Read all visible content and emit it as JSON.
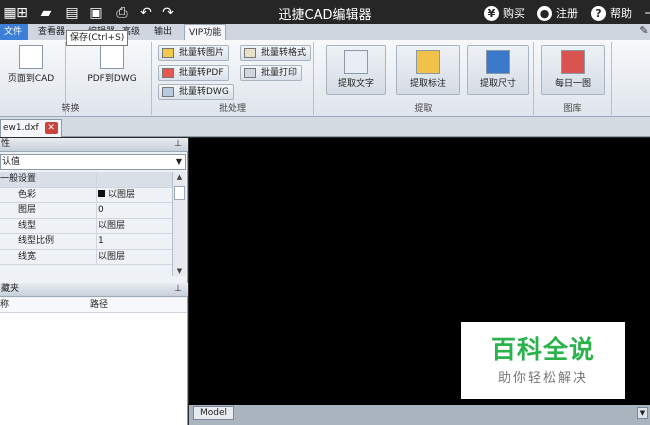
{
  "titlebar": {
    "app_title": "迅捷CAD编辑器",
    "buy_label": "购买",
    "register_label": "注册",
    "help_label": "帮助"
  },
  "tooltip": {
    "text": "保存(Ctrl+S)"
  },
  "menu": {
    "tabs": [
      "文件",
      "查看器",
      "编辑器",
      "高级",
      "输出",
      "VIP功能"
    ],
    "active": "VIP功能"
  },
  "ribbon": {
    "groups": [
      {
        "label": "转换",
        "buttons": [
          "页面到CAD",
          "PDF到DWG"
        ]
      },
      {
        "label": "批处理",
        "buttons": [
          "批量转图片",
          "批量转格式",
          "批量转PDF",
          "批量打印",
          "批量转DWG"
        ]
      },
      {
        "label": "提取",
        "buttons": [
          "提取文字",
          "提取标注",
          "提取尺寸"
        ]
      },
      {
        "label": "图库",
        "buttons": [
          "每日一图"
        ]
      }
    ]
  },
  "document": {
    "tab_label": "ew1.dxf"
  },
  "properties": {
    "header": "性",
    "dropdown_value": "认值",
    "category": "一般设置",
    "rows": [
      {
        "key": "色彩",
        "value": "以图层",
        "swatch": "#111111"
      },
      {
        "key": "图层",
        "value": "0"
      },
      {
        "key": "线型",
        "value": "以图层"
      },
      {
        "key": "线型比例",
        "value": "1"
      },
      {
        "key": "线宽",
        "value": "以图层"
      }
    ]
  },
  "favorites": {
    "header": "藏夹",
    "columns": [
      "称",
      "路径"
    ]
  },
  "canvas": {
    "model_tab": "Model",
    "background": "#000000"
  },
  "watermark": {
    "title": "百科全说",
    "subtitle": "助你轻松解决",
    "color": "#2bb24c"
  }
}
